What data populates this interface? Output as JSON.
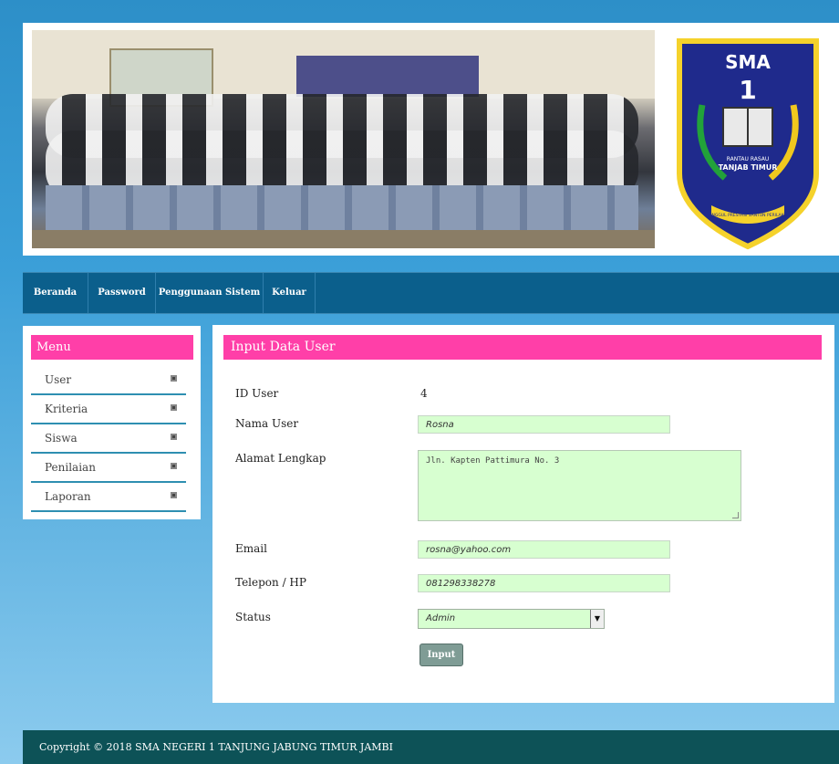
{
  "header": {
    "logo": {
      "text_top": "SMA",
      "text_number": "1",
      "text_line1": "RANTAU RASAU",
      "text_line2": "TANJAB TIMUR",
      "text_motto": "UNGGUL PRESTASI SANTUN PERILAKU"
    },
    "photo": {
      "icon": "group-photo"
    }
  },
  "nav": {
    "items": [
      {
        "label": "Beranda"
      },
      {
        "label": "Password"
      },
      {
        "label": "Penggunaan Sistem"
      },
      {
        "label": "Keluar"
      }
    ]
  },
  "sidebar": {
    "title": "Menu",
    "items": [
      {
        "label": "User",
        "icon": "bullet-icon"
      },
      {
        "label": "Kriteria",
        "icon": "bullet-icon"
      },
      {
        "label": "Siswa",
        "icon": "bullet-icon"
      },
      {
        "label": "Penilaian",
        "icon": "bullet-icon"
      },
      {
        "label": "Laporan",
        "icon": "bullet-icon"
      }
    ]
  },
  "main": {
    "title": "Input Data User",
    "fields": {
      "id_user": {
        "label": "ID User",
        "value": "4"
      },
      "nama_user": {
        "label": "Nama User",
        "value": "Rosna"
      },
      "alamat": {
        "label": "Alamat Lengkap",
        "value": "Jln. Kapten Pattimura No. 3"
      },
      "email": {
        "label": "Email",
        "value": "rosna@yahoo.com"
      },
      "telepon": {
        "label": "Telepon / HP",
        "value": "081298338278"
      },
      "status": {
        "label": "Status",
        "value": "Admin"
      }
    },
    "submit_label": "Input"
  },
  "footer": {
    "text": "Copyright © 2018 SMA NEGERI 1 TANJUNG JABUNG TIMUR JAMBI"
  },
  "colors": {
    "accent": "#ff3fa8",
    "nav": "#0b5f8c",
    "footer": "#0d5257",
    "input_bg": "#d7ffd0"
  }
}
